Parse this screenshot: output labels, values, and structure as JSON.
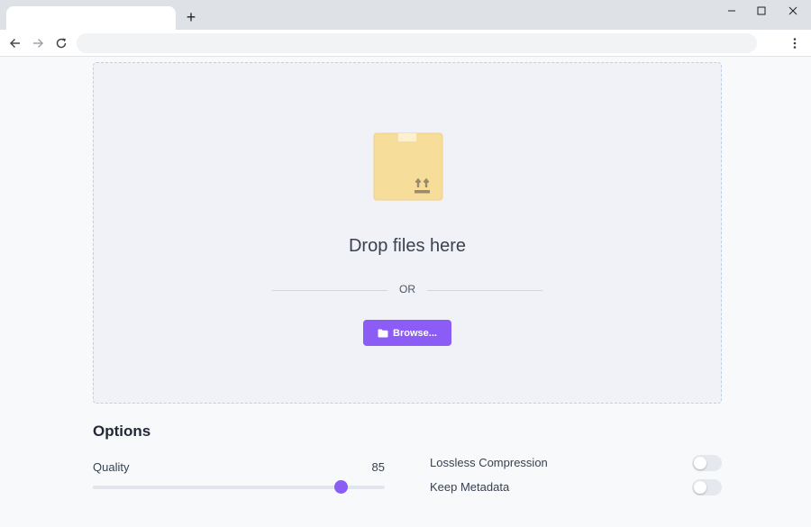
{
  "browser": {
    "new_tab_symbol": "+",
    "icons": [
      "new-tab-icon",
      "minimize-icon",
      "maximize-icon",
      "close-icon",
      "back-arrow-icon",
      "forward-arrow-icon",
      "reload-icon",
      "more-vertical-icon"
    ]
  },
  "dropzone": {
    "title": "Drop files here",
    "or_text": "OR",
    "browse_label": "Browse...",
    "icons": [
      "box-upload-icon",
      "folder-icon"
    ]
  },
  "options": {
    "title": "Options",
    "quality": {
      "label": "Quality",
      "value": "85",
      "min": 0,
      "max": 100
    },
    "toggles": [
      {
        "label": "Lossless Compression",
        "on": false
      },
      {
        "label": "Keep Metadata",
        "on": false
      }
    ]
  },
  "colors": {
    "accent": "#8b5cf6",
    "dropzone_border": "#bcd0e6",
    "box_icon": "#f7dd9a"
  }
}
